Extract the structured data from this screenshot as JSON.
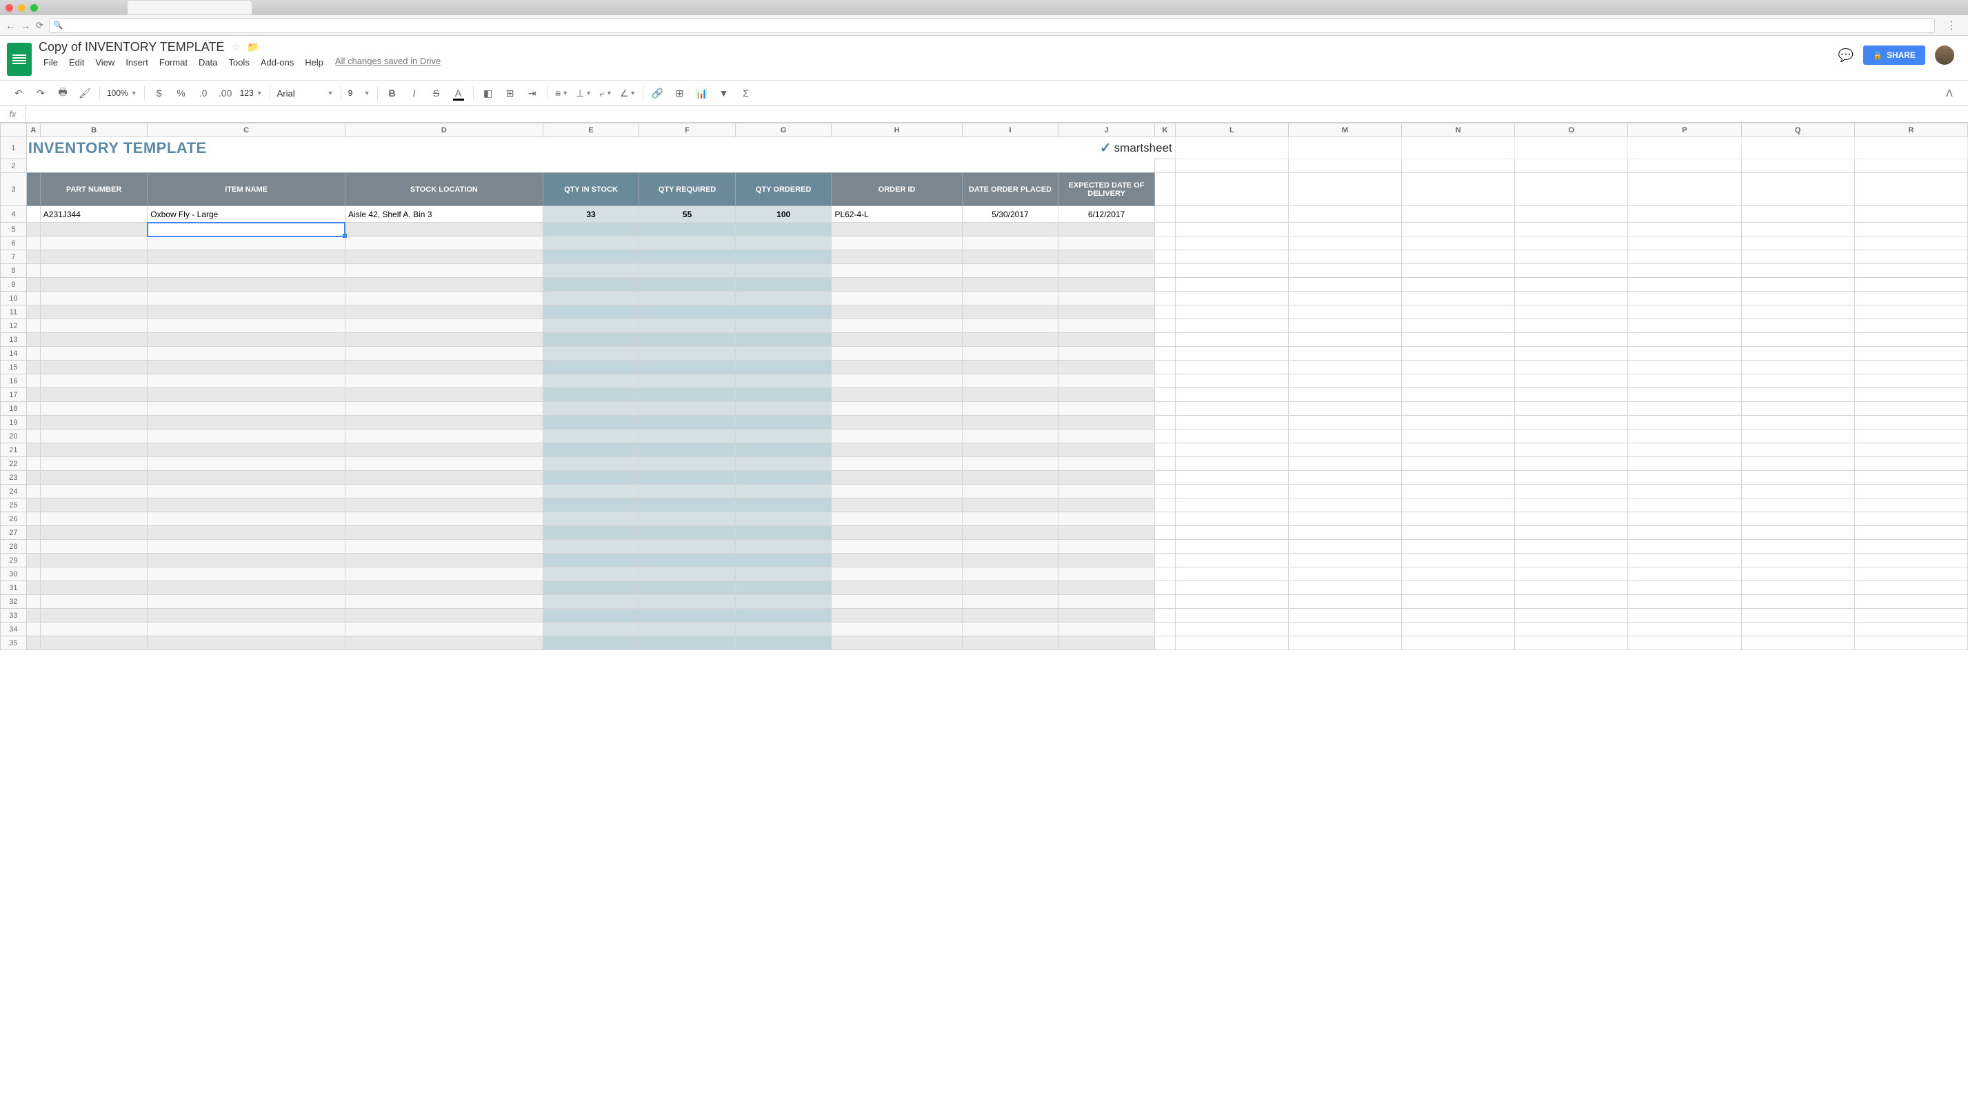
{
  "browser": {
    "url": ""
  },
  "doc": {
    "title": "Copy of INVENTORY TEMPLATE",
    "save_status": "All changes saved in Drive"
  },
  "menus": {
    "file": "File",
    "edit": "Edit",
    "view": "View",
    "insert": "Insert",
    "format": "Format",
    "data": "Data",
    "tools": "Tools",
    "addons": "Add-ons",
    "help": "Help"
  },
  "toolbar": {
    "zoom": "100%",
    "font": "Arial",
    "font_size": "9",
    "number_fmt": "123"
  },
  "share": {
    "label": "SHARE"
  },
  "formula_bar": {
    "fx": "fx",
    "value": ""
  },
  "columns": [
    "A",
    "B",
    "C",
    "D",
    "E",
    "F",
    "G",
    "H",
    "I",
    "J",
    "K",
    "L",
    "M",
    "N",
    "O",
    "P",
    "Q",
    "R"
  ],
  "sheet": {
    "title": "INVENTORY TEMPLATE",
    "logo_text": "smartsheet",
    "headers": {
      "part_number": "PART NUMBER",
      "item_name": "ITEM NAME",
      "stock_location": "STOCK LOCATION",
      "qty_in_stock": "QTY IN STOCK",
      "qty_required": "QTY REQUIRED",
      "qty_ordered": "QTY ORDERED",
      "order_id": "ORDER ID",
      "date_order_placed": "DATE ORDER PLACED",
      "expected_date": "EXPECTED DATE OF DELIVERY"
    },
    "rows": [
      {
        "part_number": "A231J344",
        "item_name": "Oxbow Fly - Large",
        "stock_location": "Aisle 42, Shelf A, Bin 3",
        "qty_in_stock": "33",
        "qty_required": "55",
        "qty_ordered": "100",
        "order_id": "PL62-4-L",
        "date_order_placed": "5/30/2017",
        "expected_date": "6/12/2017"
      }
    ]
  },
  "selected_cell": "C5"
}
